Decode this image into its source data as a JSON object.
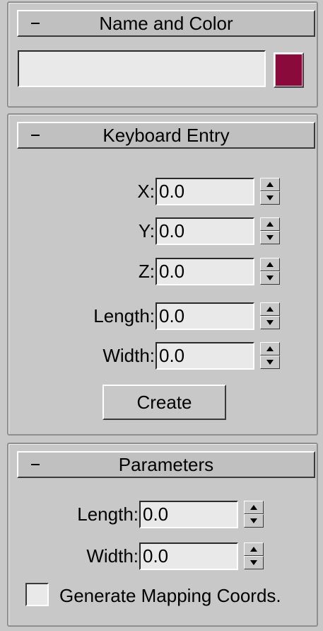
{
  "name_and_color": {
    "title": "Name and Color",
    "name_value": "",
    "color": "#8a0a3b"
  },
  "keyboard_entry": {
    "title": "Keyboard Entry",
    "fields": [
      {
        "label": "X:",
        "value": "0.0"
      },
      {
        "label": "Y:",
        "value": "0.0"
      },
      {
        "label": "Z:",
        "value": "0.0"
      },
      {
        "label": "Length:",
        "value": "0.0"
      },
      {
        "label": "Width:",
        "value": "0.0"
      }
    ],
    "create_label": "Create"
  },
  "parameters": {
    "title": "Parameters",
    "fields": [
      {
        "label": "Length:",
        "value": "0.0"
      },
      {
        "label": "Width:",
        "value": "0.0"
      }
    ],
    "generate_mapping_label": "Generate Mapping Coords.",
    "generate_mapping_checked": false
  },
  "icons": {
    "collapse": "minus-icon",
    "spin_up": "arrow-up-icon",
    "spin_down": "arrow-down-icon"
  }
}
